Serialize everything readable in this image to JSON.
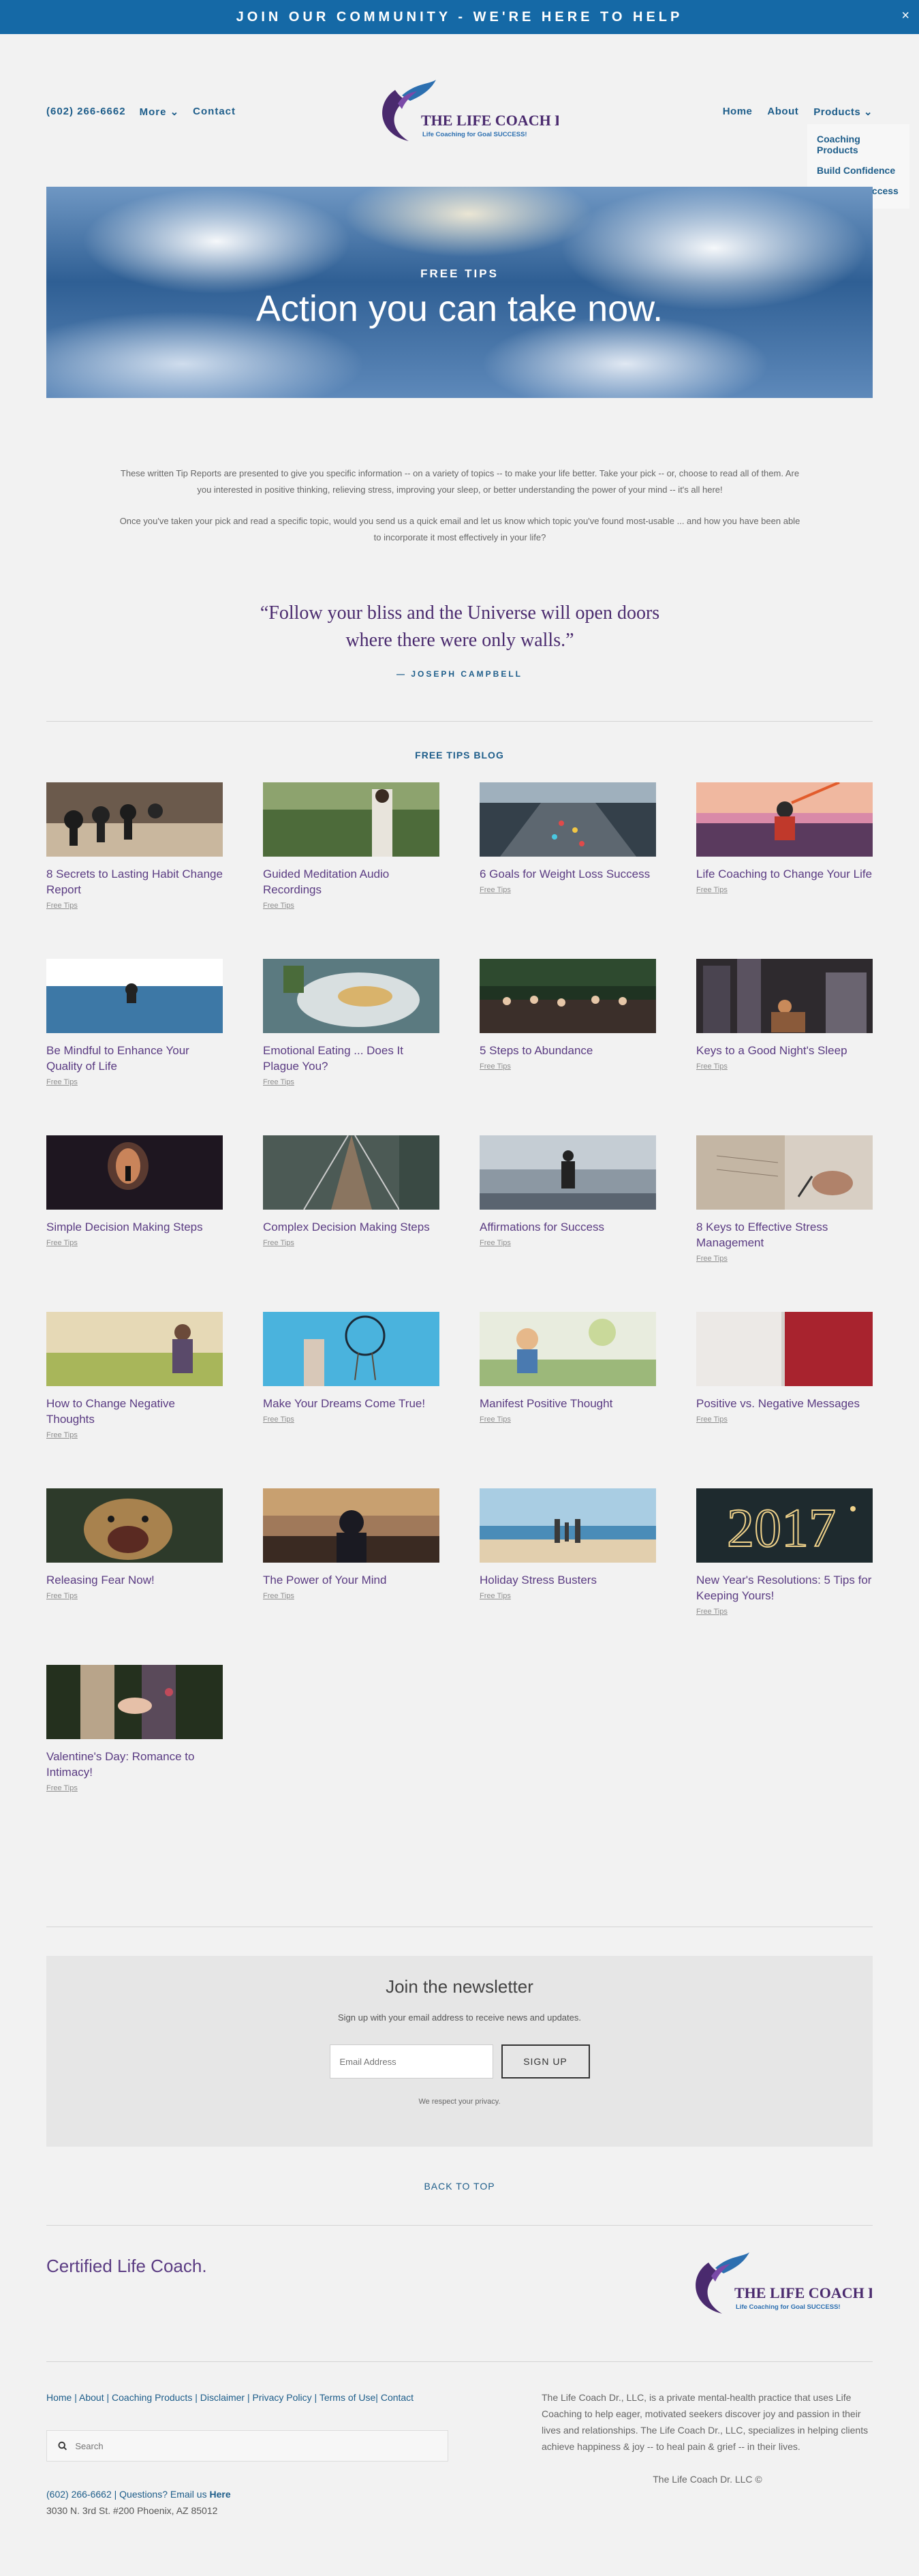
{
  "announcement": {
    "text": "JOIN OUR COMMUNITY - WE'RE HERE TO HELP",
    "close": "×"
  },
  "header": {
    "phone": "(602) 266-6662",
    "more": "More",
    "contact": "Contact",
    "logo_title": "THE LIFE COACH DR.",
    "logo_tagline": "Life Coaching for Goal SUCCESS!",
    "nav": {
      "home": "Home",
      "about": "About",
      "products": "Products"
    },
    "products_menu": [
      "Coaching Products",
      "Build Confidence",
      "Personal Success"
    ]
  },
  "hero": {
    "kicker": "FREE TIPS",
    "title": "Action you can take now."
  },
  "intro": {
    "p1": "These written Tip Reports are presented to give you specific information -- on a variety of topics -- to make your life better.   Take your pick -- or, choose to read all of them.  Are you interested in positive thinking, relieving stress, improving your sleep, or better understanding the power of your mind -- it's all here!",
    "p2": "Once you've taken your pick and read a specific topic, would you send us a quick email and let us know which topic you've found most-usable ... and how you have been able to incorporate it most effectively in your life?"
  },
  "quote": {
    "text": "“Follow your bliss and the Universe will open doors where there were only walls.”",
    "author": "— JOSEPH CAMPBELL"
  },
  "blog": {
    "heading": "FREE TIPS BLOG",
    "posts": [
      {
        "title": "8 Secrets to Lasting Habit Change Report",
        "category": "Free Tips"
      },
      {
        "title": "Guided Meditation Audio Recordings",
        "category": "Free Tips"
      },
      {
        "title": "6 Goals for Weight Loss Success",
        "category": "Free Tips"
      },
      {
        "title": "Life Coaching to Change Your Life",
        "category": "Free Tips"
      },
      {
        "title": "Be Mindful to Enhance Your Quality of Life",
        "category": "Free Tips"
      },
      {
        "title": "Emotional Eating ... Does It Plague You?",
        "category": "Free Tips"
      },
      {
        "title": "5 Steps to Abundance",
        "category": "Free Tips"
      },
      {
        "title": "Keys to a Good Night's Sleep",
        "category": "Free Tips"
      },
      {
        "title": "Simple Decision Making Steps",
        "category": "Free Tips"
      },
      {
        "title": "Complex Decision Making Steps",
        "category": "Free Tips"
      },
      {
        "title": "Affirmations for Success",
        "category": "Free Tips"
      },
      {
        "title": "8 Keys to Effective Stress Management",
        "category": "Free Tips"
      },
      {
        "title": "How to Change Negative Thoughts",
        "category": "Free Tips"
      },
      {
        "title": "Make Your Dreams Come True!",
        "category": "Free Tips"
      },
      {
        "title": "Manifest Positive Thought",
        "category": "Free Tips"
      },
      {
        "title": "Positive vs. Negative Messages",
        "category": "Free Tips"
      },
      {
        "title": "Releasing Fear Now!",
        "category": "Free Tips"
      },
      {
        "title": "The Power of Your Mind",
        "category": "Free Tips"
      },
      {
        "title": "Holiday Stress Busters",
        "category": "Free Tips"
      },
      {
        "title": "New Year's Resolutions: 5 Tips for Keeping Yours!",
        "category": "Free Tips"
      },
      {
        "title": "Valentine's Day: Romance to Intimacy!",
        "category": "Free Tips"
      }
    ]
  },
  "newsletter": {
    "title": "Join the newsletter",
    "subtitle": "Sign up with your email address to receive news and updates.",
    "placeholder": "Email Address",
    "button": "SIGN UP",
    "privacy": "We respect your privacy."
  },
  "back_to_top": "BACK TO TOP",
  "footer": {
    "certified": "Certified Life Coach.",
    "links": [
      "Home",
      "About",
      "Coaching Products",
      "Disclaimer",
      "Privacy Policy",
      "Terms of Use",
      "Contact"
    ],
    "search_placeholder": "Search",
    "phone": "(602) 266-6662",
    "question": "Questions? Email us",
    "email_link": "Here",
    "address": "3030 N. 3rd St. #200 Phoenix, AZ 85012",
    "about": "The Life Coach Dr., LLC, is a private mental-health practice that uses Life Coaching to help eager, motivated seekers discover joy and passion in their lives and relationships.  The Life Coach Dr., LLC, specializes in helping clients achieve happiness & joy -- to heal pain & grief -- in their lives.",
    "copyright": "The Life Coach Dr. LLC ©"
  }
}
